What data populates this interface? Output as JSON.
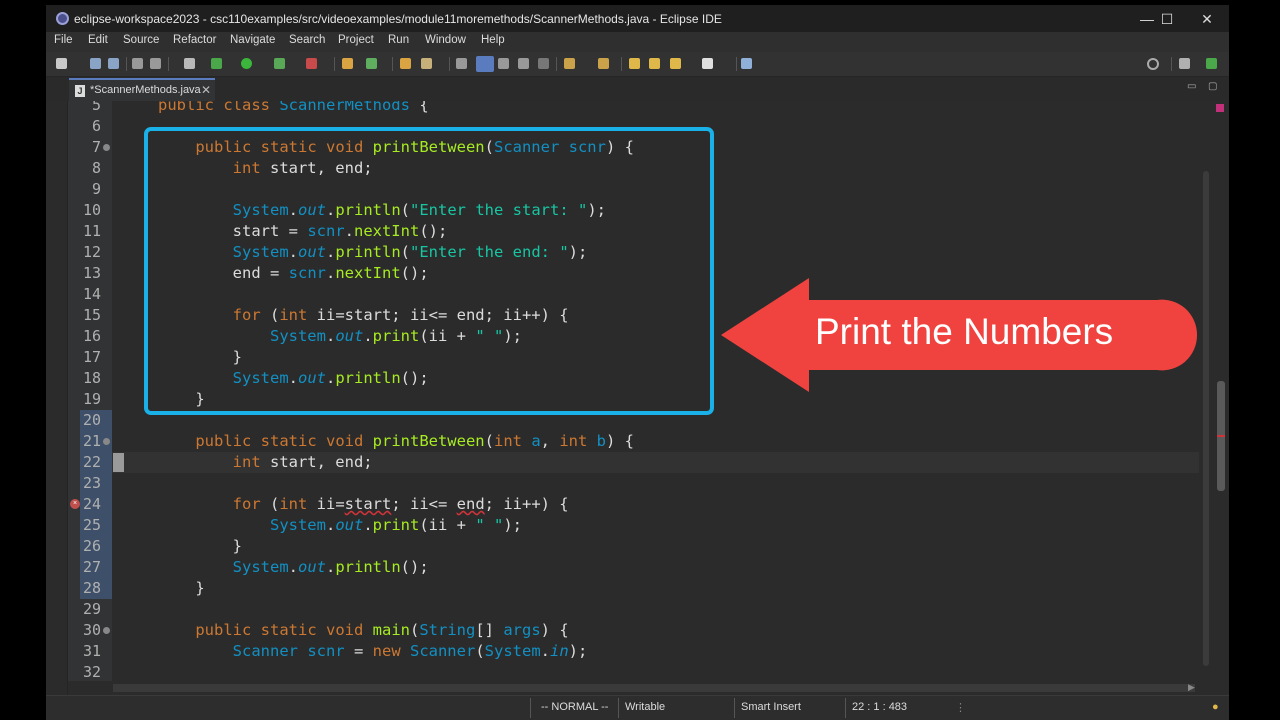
{
  "window": {
    "title": "eclipse-workspace2023 - csc110examples/src/videoexamples/module11moremethods/ScannerMethods.java - Eclipse IDE",
    "controls": {
      "minimize": "—",
      "maximize": "☐",
      "close": "✕"
    }
  },
  "menu": [
    "File",
    "Edit",
    "Source",
    "Refactor",
    "Navigate",
    "Search",
    "Project",
    "Run",
    "Window",
    "Help"
  ],
  "tab": {
    "label": "*ScannerMethods.java",
    "close": "✕",
    "icon": "J",
    "minimize": "▭",
    "maximize": "▢"
  },
  "editor": {
    "lines": [
      {
        "n": "5",
        "tokens": [
          [
            "kw",
            "public "
          ],
          [
            "kw",
            "class "
          ],
          [
            "ty",
            "ScannerMethods "
          ],
          [
            "pl",
            "{"
          ]
        ]
      },
      {
        "n": "6",
        "tokens": []
      },
      {
        "n": "7",
        "tokens": [
          [
            "pl",
            "    "
          ],
          [
            "kw",
            "public "
          ],
          [
            "kw",
            "static "
          ],
          [
            "kw",
            "void "
          ],
          [
            "mt",
            "printBetween"
          ],
          [
            "pl",
            "("
          ],
          [
            "ty",
            "Scanner "
          ],
          [
            "ty",
            "scnr"
          ],
          [
            "pl",
            ") {"
          ]
        ]
      },
      {
        "n": "8",
        "tokens": [
          [
            "pl",
            "        "
          ],
          [
            "kw",
            "int "
          ],
          [
            "pl",
            "start, end;"
          ]
        ]
      },
      {
        "n": "9",
        "tokens": []
      },
      {
        "n": "10",
        "tokens": [
          [
            "pl",
            "        "
          ],
          [
            "ty",
            "System"
          ],
          [
            "pl",
            "."
          ],
          [
            "ty it",
            "out"
          ],
          [
            "pl",
            "."
          ],
          [
            "mt",
            "println"
          ],
          [
            "pl",
            "("
          ],
          [
            "st",
            "\"Enter the start: \""
          ],
          [
            "pl",
            ");"
          ]
        ]
      },
      {
        "n": "11",
        "tokens": [
          [
            "pl",
            "        start = "
          ],
          [
            "ty",
            "scnr"
          ],
          [
            "pl",
            "."
          ],
          [
            "mt",
            "nextInt"
          ],
          [
            "pl",
            "();"
          ]
        ]
      },
      {
        "n": "12",
        "tokens": [
          [
            "pl",
            "        "
          ],
          [
            "ty",
            "System"
          ],
          [
            "pl",
            "."
          ],
          [
            "ty it",
            "out"
          ],
          [
            "pl",
            "."
          ],
          [
            "mt",
            "println"
          ],
          [
            "pl",
            "("
          ],
          [
            "st",
            "\"Enter the end: \""
          ],
          [
            "pl",
            ");"
          ]
        ]
      },
      {
        "n": "13",
        "tokens": [
          [
            "pl",
            "        end = "
          ],
          [
            "ty",
            "scnr"
          ],
          [
            "pl",
            "."
          ],
          [
            "mt",
            "nextInt"
          ],
          [
            "pl",
            "();"
          ]
        ]
      },
      {
        "n": "14",
        "tokens": []
      },
      {
        "n": "15",
        "tokens": [
          [
            "pl",
            "        "
          ],
          [
            "kw",
            "for "
          ],
          [
            "pl",
            "("
          ],
          [
            "kw",
            "int "
          ],
          [
            "pl",
            "ii=start; ii<= end; ii++) {"
          ]
        ]
      },
      {
        "n": "16",
        "tokens": [
          [
            "pl",
            "            "
          ],
          [
            "ty",
            "System"
          ],
          [
            "pl",
            "."
          ],
          [
            "ty it",
            "out"
          ],
          [
            "pl",
            "."
          ],
          [
            "mt",
            "print"
          ],
          [
            "pl",
            "(ii + "
          ],
          [
            "st",
            "\" \""
          ],
          [
            "pl",
            ");"
          ]
        ]
      },
      {
        "n": "17",
        "tokens": [
          [
            "pl",
            "        }"
          ]
        ]
      },
      {
        "n": "18",
        "tokens": [
          [
            "pl",
            "        "
          ],
          [
            "ty",
            "System"
          ],
          [
            "pl",
            "."
          ],
          [
            "ty it",
            "out"
          ],
          [
            "pl",
            "."
          ],
          [
            "mt",
            "println"
          ],
          [
            "pl",
            "();"
          ]
        ]
      },
      {
        "n": "19",
        "tokens": [
          [
            "pl",
            "    }"
          ]
        ]
      },
      {
        "n": "20",
        "tokens": []
      },
      {
        "n": "21",
        "tokens": [
          [
            "pl",
            "    "
          ],
          [
            "kw",
            "public "
          ],
          [
            "kw",
            "static "
          ],
          [
            "kw",
            "void "
          ],
          [
            "mt",
            "printBetween"
          ],
          [
            "pl",
            "("
          ],
          [
            "kw",
            "int "
          ],
          [
            "ty",
            "a"
          ],
          [
            "pl",
            ", "
          ],
          [
            "kw",
            "int "
          ],
          [
            "ty",
            "b"
          ],
          [
            "pl",
            ") {"
          ]
        ]
      },
      {
        "n": "22",
        "tokens": [
          [
            "pl",
            "        "
          ],
          [
            "kw",
            "int "
          ],
          [
            "pl",
            "start, end;"
          ]
        ]
      },
      {
        "n": "23",
        "tokens": []
      },
      {
        "n": "24",
        "tokens": [
          [
            "pl",
            "        "
          ],
          [
            "kw",
            "for "
          ],
          [
            "pl",
            "("
          ],
          [
            "kw",
            "int "
          ],
          [
            "pl",
            "ii="
          ],
          [
            "ul",
            "start"
          ],
          [
            "pl",
            "; ii<= "
          ],
          [
            "ul",
            "end"
          ],
          [
            "pl",
            "; ii++) {"
          ]
        ]
      },
      {
        "n": "25",
        "tokens": [
          [
            "pl",
            "            "
          ],
          [
            "ty",
            "System"
          ],
          [
            "pl",
            "."
          ],
          [
            "ty it",
            "out"
          ],
          [
            "pl",
            "."
          ],
          [
            "mt",
            "print"
          ],
          [
            "pl",
            "(ii + "
          ],
          [
            "st",
            "\" \""
          ],
          [
            "pl",
            ");"
          ]
        ]
      },
      {
        "n": "26",
        "tokens": [
          [
            "pl",
            "        }"
          ]
        ]
      },
      {
        "n": "27",
        "tokens": [
          [
            "pl",
            "        "
          ],
          [
            "ty",
            "System"
          ],
          [
            "pl",
            "."
          ],
          [
            "ty it",
            "out"
          ],
          [
            "pl",
            "."
          ],
          [
            "mt",
            "println"
          ],
          [
            "pl",
            "();"
          ]
        ]
      },
      {
        "n": "28",
        "tokens": [
          [
            "pl",
            "    }"
          ]
        ]
      },
      {
        "n": "29",
        "tokens": []
      },
      {
        "n": "30",
        "tokens": [
          [
            "pl",
            "    "
          ],
          [
            "kw",
            "public "
          ],
          [
            "kw",
            "static "
          ],
          [
            "kw",
            "void "
          ],
          [
            "mt",
            "main"
          ],
          [
            "pl",
            "("
          ],
          [
            "ty",
            "String"
          ],
          [
            "pl",
            "[] "
          ],
          [
            "ty",
            "args"
          ],
          [
            "pl",
            ") {"
          ]
        ]
      },
      {
        "n": "31",
        "tokens": [
          [
            "pl",
            "        "
          ],
          [
            "ty",
            "Scanner "
          ],
          [
            "ty",
            "scnr "
          ],
          [
            "pl",
            "= "
          ],
          [
            "kw",
            "new "
          ],
          [
            "ty",
            "Scanner"
          ],
          [
            "pl",
            "("
          ],
          [
            "ty",
            "System"
          ],
          [
            "pl",
            "."
          ],
          [
            "ty it",
            "in"
          ],
          [
            "pl",
            ");"
          ]
        ]
      },
      {
        "n": "32",
        "tokens": []
      }
    ],
    "fold_lines": [
      "7",
      "21",
      "30"
    ],
    "selected_lines": [
      "20",
      "21",
      "22",
      "23",
      "24",
      "25",
      "26",
      "27",
      "28"
    ],
    "current_line": "22",
    "error_line": "24"
  },
  "status": {
    "mode": "-- NORMAL --",
    "writable": "Writable",
    "insert": "Smart Insert",
    "position": "22 : 1 : 483"
  },
  "annotation": {
    "callout": "Print the Numbers",
    "box_color": "#1ab0e8",
    "arrow_color": "#f0433f"
  }
}
